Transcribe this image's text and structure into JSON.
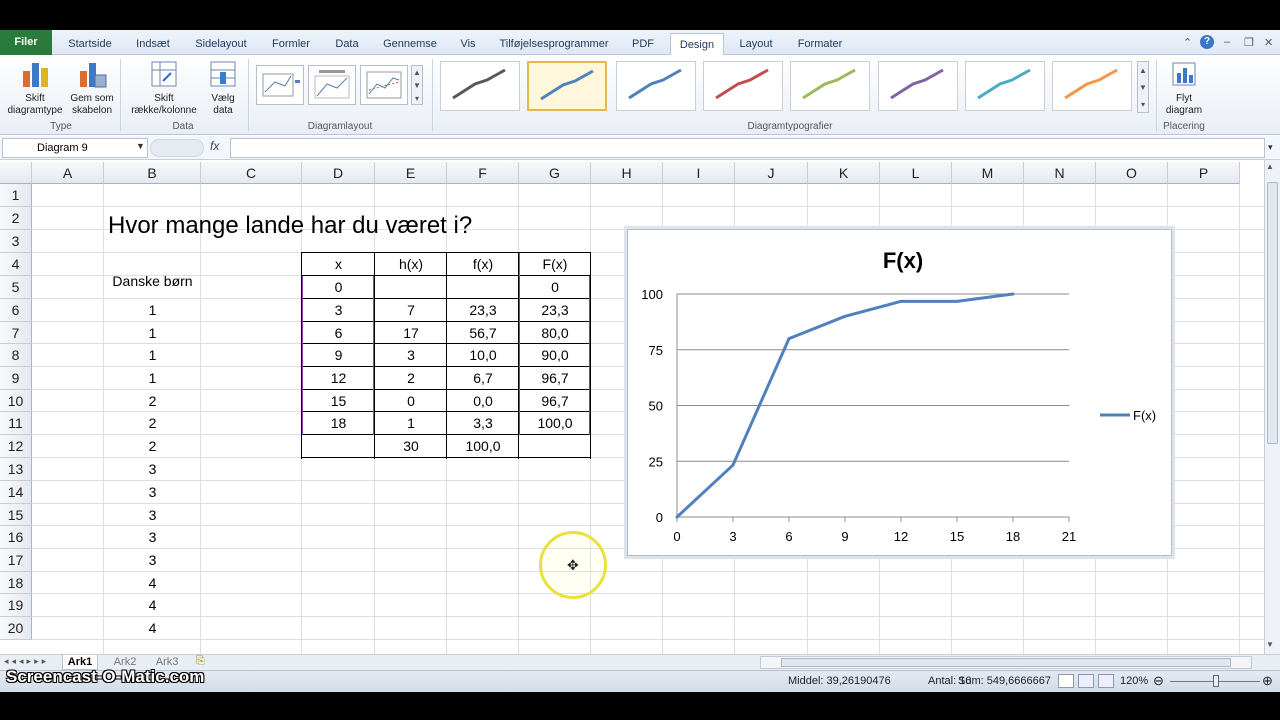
{
  "ribbon": {
    "tabs": [
      "Filer",
      "Startside",
      "Indsæt",
      "Sidelayout",
      "Formler",
      "Data",
      "Gennemse",
      "Vis",
      "Tilføjelsesprogrammer",
      "PDF",
      "Design",
      "Layout",
      "Formater"
    ],
    "active_tab": "Design",
    "buttons": {
      "skift_diagramtype": "Skift\ndiagramtype",
      "gem_som_skabelon": "Gem som\nskabelon",
      "skift_rk": "Skift\nrække/kolonne",
      "vaelg_data": "Vælg\ndata",
      "flyt_diagram": "Flyt\ndiagram"
    },
    "groups": {
      "type": "Type",
      "data": "Data",
      "layout": "Diagramlayout",
      "styles": "Diagramtypografier",
      "placering": "Placering"
    },
    "style_colors": [
      "#595959",
      "#4f81bd",
      "#4f81bd",
      "#c0504d",
      "#9bbb59",
      "#8064a2",
      "#4bacc6",
      "#f79646"
    ]
  },
  "formula_bar": {
    "name_box": "Diagram 9",
    "fx": "fx",
    "value": ""
  },
  "columns": [
    "A",
    "B",
    "C",
    "D",
    "E",
    "F",
    "G",
    "H",
    "I",
    "J",
    "K",
    "L",
    "M",
    "N",
    "O",
    "P"
  ],
  "rows": [
    "1",
    "2",
    "3",
    "4",
    "5",
    "6",
    "7",
    "8",
    "9",
    "10",
    "11",
    "12",
    "13",
    "14",
    "15",
    "16",
    "17",
    "18",
    "19",
    "20"
  ],
  "sheet": {
    "title": "Hvor mange lande har du været i?",
    "b_header": "Danske børn",
    "b_values": [
      "1",
      "1",
      "1",
      "1",
      "2",
      "2",
      "2",
      "3",
      "3",
      "3",
      "3",
      "3",
      "4",
      "4",
      "4"
    ],
    "table_header": [
      "x",
      "h(x)",
      "f(x)",
      "F(x)"
    ],
    "table_rows": [
      [
        "0",
        "",
        "",
        "0"
      ],
      [
        "3",
        "7",
        "23,3",
        "23,3"
      ],
      [
        "6",
        "17",
        "56,7",
        "80,0"
      ],
      [
        "9",
        "3",
        "10,0",
        "90,0"
      ],
      [
        "12",
        "2",
        "6,7",
        "96,7"
      ],
      [
        "15",
        "0",
        "0,0",
        "96,7"
      ],
      [
        "18",
        "1",
        "3,3",
        "100,0"
      ],
      [
        "",
        "30",
        "100,0",
        ""
      ]
    ]
  },
  "chart_data": {
    "type": "line",
    "title": "F(x)",
    "x": [
      0,
      3,
      6,
      9,
      12,
      15,
      18
    ],
    "series": [
      {
        "name": "F(x)",
        "values": [
          0,
          23.3,
          80.0,
          90.0,
          96.7,
          96.7,
          100.0
        ],
        "color": "#4f81bd"
      }
    ],
    "xticks": [
      "0",
      "3",
      "6",
      "9",
      "12",
      "15",
      "18",
      "21"
    ],
    "yticks": [
      "0",
      "25",
      "50",
      "75",
      "100"
    ],
    "xlim": [
      0,
      21
    ],
    "ylim": [
      0,
      100
    ],
    "grid": true,
    "legend": "right"
  },
  "sheet_tabs": [
    "Ark1",
    "Ark2",
    "Ark3"
  ],
  "active_sheet": "Ark1",
  "status": {
    "middel": "Middel: 39,26190476",
    "antal": "Antal: 16",
    "sum": "Sum: 549,6666667",
    "zoom": "120%"
  },
  "watermark": "Screencast-O-Matic.com"
}
